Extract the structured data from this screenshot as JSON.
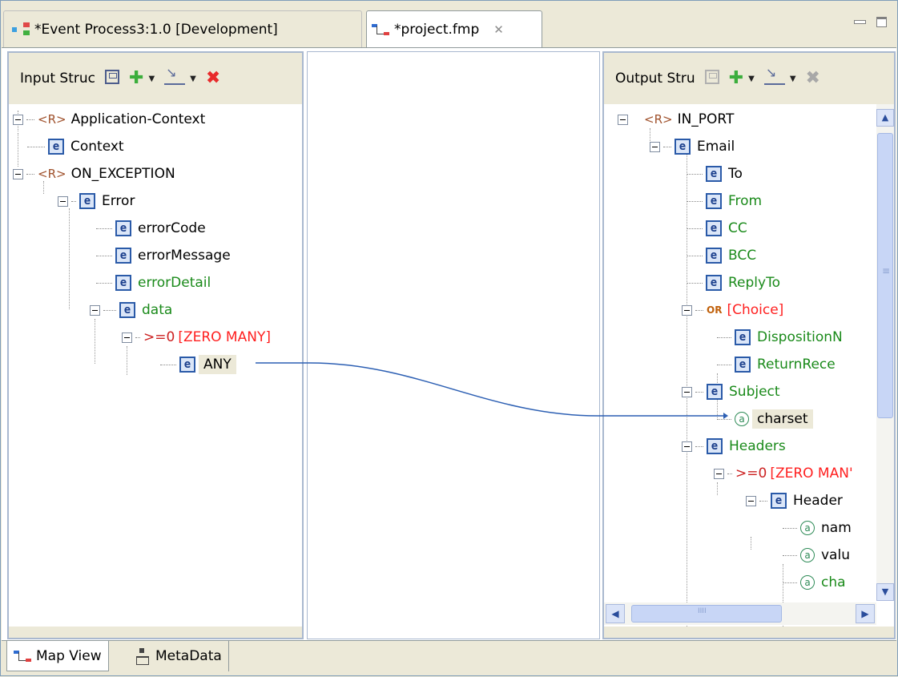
{
  "tabs": [
    {
      "label": "*Event Process3:1.0 [Development]"
    },
    {
      "label": "*project.fmp",
      "close": "✕"
    }
  ],
  "input_panel": {
    "title": "Input Struc",
    "tree": [
      {
        "label": "Application-Context",
        "kind": "R",
        "prefix": "<R>"
      },
      {
        "label": "Context",
        "kind": "e"
      },
      {
        "label": "ON_EXCEPTION",
        "kind": "R",
        "prefix": "<R>"
      },
      {
        "label": "Error",
        "kind": "e"
      },
      {
        "label": "errorCode",
        "kind": "e"
      },
      {
        "label": "errorMessage",
        "kind": "e"
      },
      {
        "label": "errorDetail",
        "kind": "e"
      },
      {
        "label": "data",
        "kind": "e"
      },
      {
        "label": "[ZERO MANY]",
        "kind": "ge",
        "prefix": ">=0"
      },
      {
        "label": "ANY",
        "kind": "e"
      }
    ]
  },
  "output_panel": {
    "title": "Output Stru",
    "tree": [
      {
        "label": "IN_PORT",
        "kind": "R",
        "prefix": "<R>"
      },
      {
        "label": "Email",
        "kind": "e"
      },
      {
        "label": "To",
        "kind": "e"
      },
      {
        "label": "From",
        "kind": "e"
      },
      {
        "label": "CC",
        "kind": "e"
      },
      {
        "label": "BCC",
        "kind": "e"
      },
      {
        "label": "ReplyTo",
        "kind": "e"
      },
      {
        "label": "[Choice]",
        "kind": "or",
        "prefix": "OR"
      },
      {
        "label": "DispositionN",
        "kind": "e"
      },
      {
        "label": "ReturnRece",
        "kind": "e"
      },
      {
        "label": "Subject",
        "kind": "e"
      },
      {
        "label": "charset",
        "kind": "a"
      },
      {
        "label": "Headers",
        "kind": "e"
      },
      {
        "label": "[ZERO MAN'",
        "kind": "ge",
        "prefix": ">=0"
      },
      {
        "label": "Header",
        "kind": "e"
      },
      {
        "label": "nam",
        "kind": "a"
      },
      {
        "label": "valu",
        "kind": "a"
      },
      {
        "label": "cha",
        "kind": "a"
      }
    ],
    "hscroll_grip": "IIII",
    "vscroll_grip": "≡"
  },
  "bottom_tabs": [
    {
      "label": "Map View"
    },
    {
      "label": "MetaData"
    }
  ],
  "glyphs": {
    "e": "e",
    "a": "a",
    "plus": "✚",
    "delete": "✖",
    "dropdown": "▼",
    "up": "▲",
    "down": "▼",
    "left": "◀",
    "right": "▶"
  },
  "colors": {
    "mapping_line": "#2c5fb3",
    "required_text": "#000000",
    "optional_text": "#1a8a1a",
    "repeat_text": "#ff2020"
  }
}
